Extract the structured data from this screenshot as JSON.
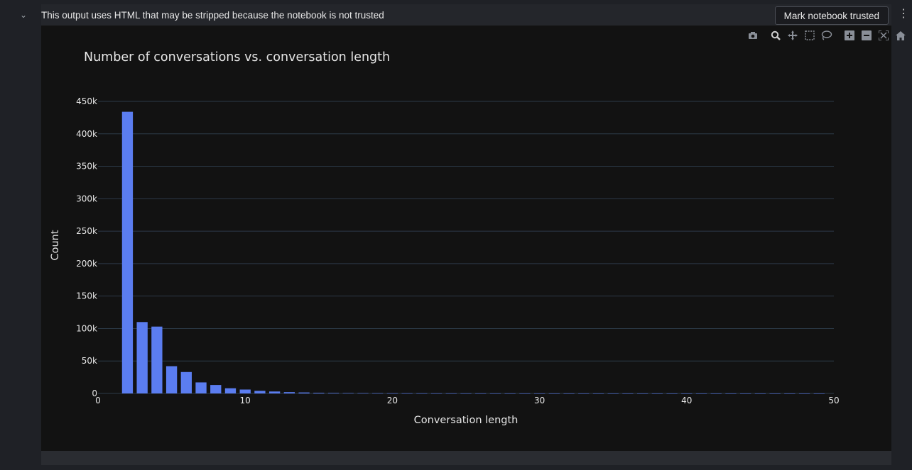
{
  "notebook": {
    "warning_text": "This output uses HTML that may be stripped because the notebook is not trusted",
    "trust_button_label": "Mark notebook trusted",
    "menu_glyph": "⋮",
    "collapse_glyph": "⌄"
  },
  "modebar": {
    "icons": [
      "camera-icon",
      "zoom-icon",
      "pan-icon",
      "box-select-icon",
      "lasso-icon",
      "zoom-in-icon",
      "zoom-out-icon",
      "autoscale-icon",
      "reset-axes-icon",
      "plotly-logo-icon"
    ]
  },
  "colors": {
    "bar": "#5b7df0",
    "grid": "#2c3a48",
    "plot_bg": "#121212",
    "text": "#e6e6e6"
  },
  "chart_data": {
    "type": "bar",
    "title": "Number of conversations vs. conversation length",
    "xlabel": "Conversation length",
    "ylabel": "Count",
    "xlim": [
      0,
      50
    ],
    "ylim": [
      0,
      450000
    ],
    "x_ticks": [
      0,
      10,
      20,
      30,
      40,
      50
    ],
    "y_ticks": [
      0,
      50000,
      100000,
      150000,
      200000,
      250000,
      300000,
      350000,
      400000,
      450000
    ],
    "y_tick_labels": [
      "0",
      "50k",
      "100k",
      "150k",
      "200k",
      "250k",
      "300k",
      "350k",
      "400k",
      "450k"
    ],
    "grid": true,
    "x": [
      2,
      3,
      4,
      5,
      6,
      7,
      8,
      9,
      10,
      11,
      12,
      13,
      14,
      15,
      16,
      17,
      18,
      19,
      20,
      21,
      22,
      23,
      24,
      25,
      26,
      27,
      28,
      29,
      30,
      31,
      32,
      33,
      34,
      35,
      36,
      37,
      38,
      39,
      40,
      41,
      42,
      43,
      44,
      45,
      46,
      47,
      48,
      49
    ],
    "values": [
      434000,
      110000,
      103000,
      42000,
      33000,
      17000,
      13000,
      8000,
      6000,
      4000,
      3000,
      2000,
      1500,
      1000,
      800,
      600,
      500,
      400,
      300,
      250,
      200,
      180,
      160,
      140,
      120,
      100,
      90,
      80,
      70,
      60,
      55,
      50,
      45,
      40,
      35,
      30,
      28,
      25,
      22,
      20,
      18,
      16,
      14,
      12,
      10,
      9,
      8,
      7
    ]
  }
}
